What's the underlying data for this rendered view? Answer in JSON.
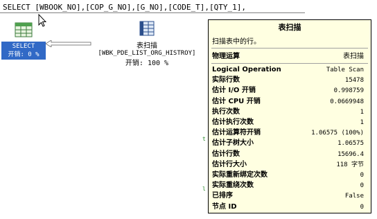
{
  "query": {
    "text": "SELECT [WBOOK_NO],[COP_G_NO],[G_NO],[CODE_T],[QTY_1],"
  },
  "select_node": {
    "label": "SELECT",
    "cost": "开销: 0 %"
  },
  "scan_node": {
    "title": "表扫描",
    "table": "[WBK_PDE_LIST_ORG_HISTROY]",
    "cost": "开销: 100 %"
  },
  "tooltip": {
    "title": "表扫描",
    "description": "扫描表中的行。",
    "header": {
      "key": "物理运算",
      "value": "表扫描"
    },
    "rows": [
      {
        "key": "Logical Operation",
        "value": "Table Scan"
      },
      {
        "key": "实际行数",
        "value": "15478"
      },
      {
        "key": "估计 I/O 开销",
        "value": "0.998759"
      },
      {
        "key": "估计 CPU 开销",
        "value": "0.0669948"
      },
      {
        "key": "执行次数",
        "value": "1"
      },
      {
        "key": "估计执行次数",
        "value": "1"
      },
      {
        "key": "估计运算符开销",
        "value": "1.06575 (100%)"
      },
      {
        "key": "估计子树大小",
        "value": "1.06575"
      },
      {
        "key": "估计行数",
        "value": "15696.4"
      },
      {
        "key": "估计行大小",
        "value": "118 字节"
      },
      {
        "key": "实际重新绑定次数",
        "value": "0"
      },
      {
        "key": "实际重绕次数",
        "value": "0"
      },
      {
        "key": "已排序",
        "value": "False"
      },
      {
        "key": "节点 ID",
        "value": "0"
      }
    ]
  },
  "colors": {
    "tooltip_bg": "#ffffe1",
    "selection_bg": "#3169c6"
  }
}
